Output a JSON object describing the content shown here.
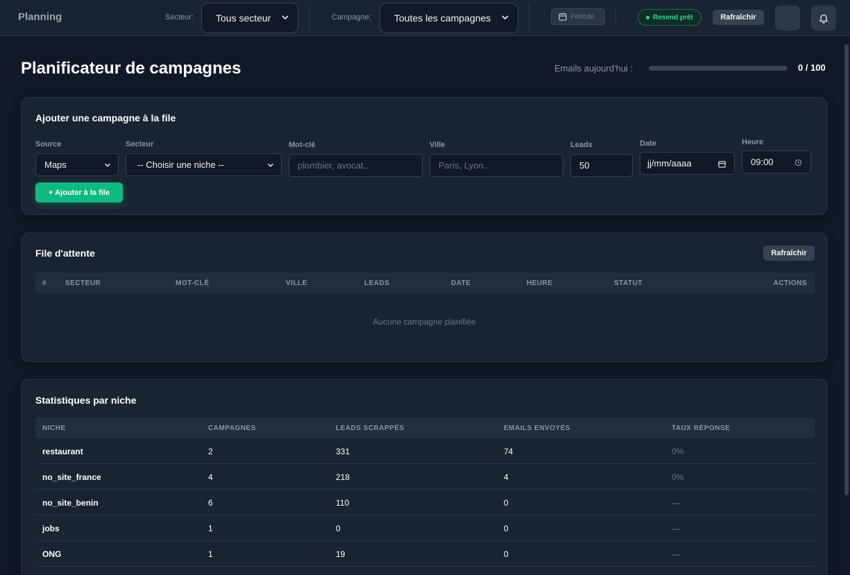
{
  "topbar": {
    "brand": "Planning",
    "sector_label": "Secteur:",
    "sector_value": "Tous secteur",
    "campaign_label": "Campagne:",
    "campaign_value": "Toutes les campagnes",
    "period_label": "Période",
    "resend_status": "Resend prêt",
    "refresh_label": "Rafraîchir"
  },
  "header": {
    "title": "Planificateur de campagnes",
    "emails_label": "Emails aujourd'hui :",
    "emails_count": "0 / 100",
    "emails_progress": 0.0
  },
  "add_form": {
    "title": "Ajouter une campagne à la file",
    "source": {
      "label": "Source",
      "value": "Maps"
    },
    "sector": {
      "label": "Secteur",
      "value": "-- Choisir une niche --"
    },
    "keyword": {
      "label": "Mot-clé",
      "placeholder": "plombier, avocat..."
    },
    "city": {
      "label": "Ville",
      "placeholder": "Paris, Lyon..."
    },
    "leads": {
      "label": "Leads",
      "value": "50"
    },
    "date": {
      "label": "Date",
      "placeholder": "jj/mm/aaaa"
    },
    "time": {
      "label": "Heure",
      "value": "09:00"
    },
    "submit_label": "+ Ajouter à la file"
  },
  "queue": {
    "title": "File d'attente",
    "refresh_label": "Rafraîchir",
    "columns": [
      "#",
      "SECTEUR",
      "MOT-CLÉ",
      "VILLE",
      "LEADS",
      "DATE",
      "HEURE",
      "STATUT",
      "ACTIONS"
    ],
    "empty_message": "Aucune campagne planifiée"
  },
  "stats": {
    "title": "Statistiques par niche",
    "columns": [
      "NICHE",
      "CAMPAGNES",
      "LEADS SCRAPPÉS",
      "EMAILS ENVOYÉS",
      "TAUX RÉPONSE"
    ],
    "rows": [
      {
        "niche": "restaurant",
        "campaigns": "2",
        "leads": "331",
        "emails": "74",
        "rate": "0%"
      },
      {
        "niche": "no_site_france",
        "campaigns": "4",
        "leads": "218",
        "emails": "4",
        "rate": "0%"
      },
      {
        "niche": "no_site_benin",
        "campaigns": "6",
        "leads": "110",
        "emails": "0",
        "rate": "—"
      },
      {
        "niche": "jobs",
        "campaigns": "1",
        "leads": "0",
        "emails": "0",
        "rate": "—"
      },
      {
        "niche": "ONG",
        "campaigns": "1",
        "leads": "19",
        "emails": "0",
        "rate": "—"
      }
    ]
  },
  "icons": {
    "chevron": "chevron-down-icon",
    "calendar": "calendar-icon",
    "clock": "clock-icon",
    "bell": "bell-icon"
  },
  "colors": {
    "accent": "#10b981",
    "background": "#111827",
    "card": "#1a2332"
  }
}
